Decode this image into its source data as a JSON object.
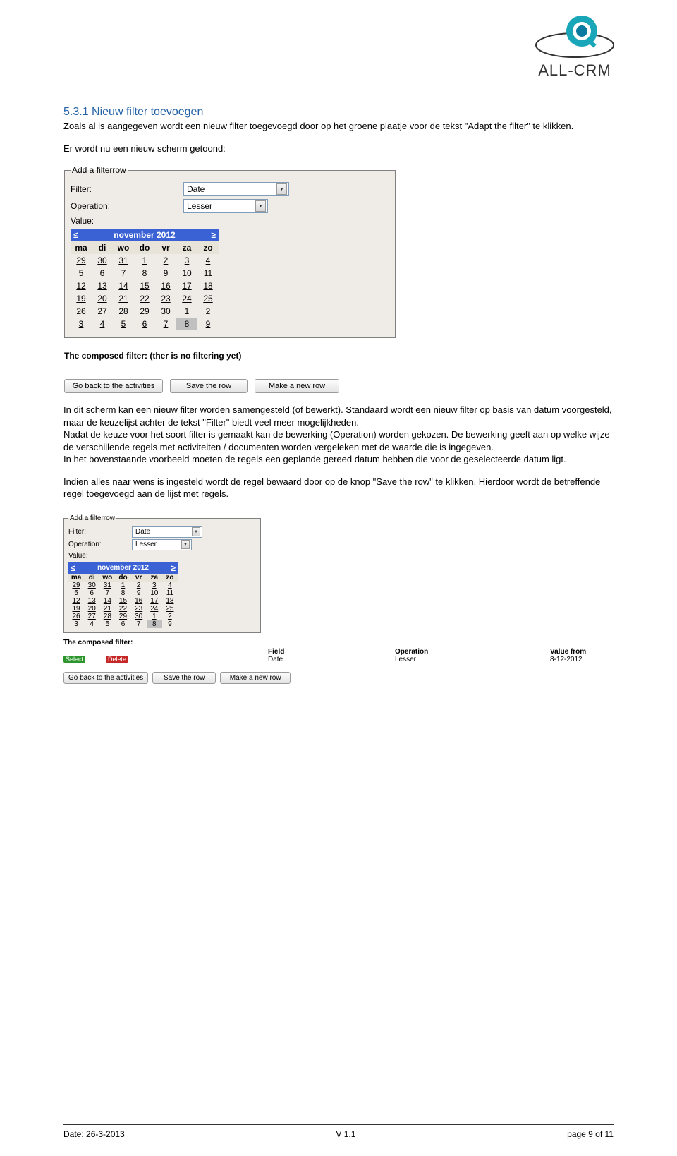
{
  "logo": {
    "text": "ALL-CRM"
  },
  "heading": "5.3.1 Nieuw filter toevoegen",
  "para1": "Zoals al is aangegeven wordt een nieuw filter toegevoegd door op het groene plaatje voor de tekst \"Adapt the filter\" te klikken.",
  "para2": "Er wordt nu een nieuw scherm getoond:",
  "shot1": {
    "legend": "Add a filterrow",
    "rows": {
      "filter_label": "Filter:",
      "filter_value": "Date",
      "operation_label": "Operation:",
      "operation_value": "Lesser",
      "value_label": "Value:"
    },
    "calendar": {
      "prev": "≤",
      "next": "≥",
      "month": "november 2012",
      "days": [
        "ma",
        "di",
        "wo",
        "do",
        "vr",
        "za",
        "zo"
      ],
      "weeks": [
        [
          "29",
          "30",
          "31",
          "1",
          "2",
          "3",
          "4"
        ],
        [
          "5",
          "6",
          "7",
          "8",
          "9",
          "10",
          "11"
        ],
        [
          "12",
          "13",
          "14",
          "15",
          "16",
          "17",
          "18"
        ],
        [
          "19",
          "20",
          "21",
          "22",
          "23",
          "24",
          "25"
        ],
        [
          "26",
          "27",
          "28",
          "29",
          "30",
          "1",
          "2"
        ],
        [
          "3",
          "4",
          "5",
          "6",
          "7",
          "8",
          "9"
        ]
      ],
      "selected": "8"
    },
    "composed_label": "The composed filter: (ther is no filtering yet)",
    "buttons": {
      "back": "Go back to the activities",
      "save": "Save the row",
      "new": "Make a new row"
    }
  },
  "para3": "In dit scherm kan een nieuw filter worden samengesteld (of bewerkt). Standaard wordt een nieuw filter op basis van datum voorgesteld, maar de keuzelijst achter de tekst \"Filter\" biedt veel meer mogelijkheden.",
  "para4": "Nadat de keuze voor het soort filter is gemaakt kan de bewerking (Operation) worden gekozen. De bewerking geeft aan op welke wijze de verschillende regels met activiteiten / documenten worden vergeleken met de waarde die is ingegeven.",
  "para5": "In het bovenstaande voorbeeld moeten de regels een geplande gereed datum hebben die voor de geselecteerde datum ligt.",
  "para6": "Indien alles naar wens is ingesteld wordt de regel bewaard door op de knop \"Save the row\" te klikken. Hierdoor wordt de betreffende regel toegevoegd aan de lijst met regels.",
  "shot2": {
    "legend": "Add a filterrow",
    "rows": {
      "filter_label": "Filter:",
      "filter_value": "Date",
      "operation_label": "Operation:",
      "operation_value": "Lesser",
      "value_label": "Value:"
    },
    "calendar": {
      "prev": "≤",
      "next": "≥",
      "month": "november 2012",
      "days": [
        "ma",
        "di",
        "wo",
        "do",
        "vr",
        "za",
        "zo"
      ],
      "weeks": [
        [
          "29",
          "30",
          "31",
          "1",
          "2",
          "3",
          "4"
        ],
        [
          "5",
          "6",
          "7",
          "8",
          "9",
          "10",
          "11"
        ],
        [
          "12",
          "13",
          "14",
          "15",
          "16",
          "17",
          "18"
        ],
        [
          "19",
          "20",
          "21",
          "22",
          "23",
          "24",
          "25"
        ],
        [
          "26",
          "27",
          "28",
          "29",
          "30",
          "1",
          "2"
        ],
        [
          "3",
          "4",
          "5",
          "6",
          "7",
          "8",
          "9"
        ]
      ],
      "selected": "8"
    },
    "composed_label": "The composed filter:",
    "grid": {
      "headers": {
        "field": "Field",
        "operation": "Operation",
        "value_from": "Value from"
      },
      "row": {
        "select": "Select",
        "delete": "Delete",
        "field": "Date",
        "operation": "Lesser",
        "value_from": "8-12-2012"
      }
    },
    "buttons": {
      "back": "Go back to the activities",
      "save": "Save the row",
      "new": "Make a new row"
    }
  },
  "footer": {
    "date": "Date: 26-3-2013",
    "version": "V 1.1",
    "page": "page 9 of 11"
  }
}
